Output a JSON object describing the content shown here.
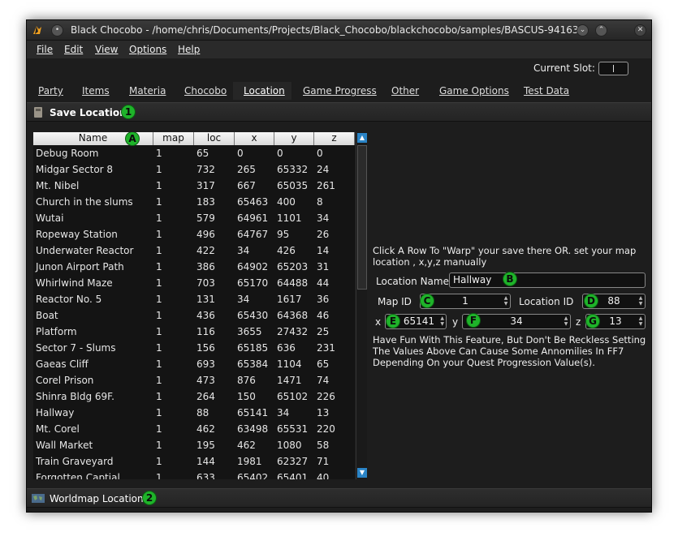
{
  "window": {
    "title": "Black Chocobo - /home/chris/Documents/Projects/Black_Chocobo/blackchocobo/samples/BASCUS-94163..."
  },
  "menu": [
    "File",
    "Edit",
    "View",
    "Options",
    "Help"
  ],
  "slot": {
    "label": "Current Slot:",
    "value": ""
  },
  "tabs": [
    "Party",
    "Items",
    "Materia",
    "Chocobo",
    "Location",
    "Game Progress",
    "Other",
    "Game Options",
    "Test Data"
  ],
  "active_tab": "Location",
  "sections": {
    "save_location": "Save Location",
    "worldmap_location": "Worldmap Location"
  },
  "markers": {
    "one": "1",
    "two": "2",
    "A": "A",
    "B": "B",
    "C": "C",
    "D": "D",
    "E": "E",
    "F": "F",
    "G": "G"
  },
  "table": {
    "columns": [
      "Name",
      "map",
      "loc",
      "x",
      "y",
      "z"
    ],
    "rows": [
      [
        "Debug Room",
        "1",
        "65",
        "0",
        "0",
        "0"
      ],
      [
        "Midgar Sector 8",
        "1",
        "732",
        "265",
        "65332",
        "24"
      ],
      [
        "Mt. Nibel",
        "1",
        "317",
        "667",
        "65035",
        "261"
      ],
      [
        "Church in the slums",
        "1",
        "183",
        "65463",
        "400",
        "8"
      ],
      [
        "Wutai",
        "1",
        "579",
        "64961",
        "1101",
        "34"
      ],
      [
        "Ropeway Station",
        "1",
        "496",
        "64767",
        "95",
        "26"
      ],
      [
        "Underwater Reactor",
        "1",
        "422",
        "34",
        "426",
        "14"
      ],
      [
        "Junon Airport Path",
        "1",
        "386",
        "64902",
        "65203",
        "31"
      ],
      [
        "Whirlwind Maze",
        "1",
        "703",
        "65170",
        "64488",
        "44"
      ],
      [
        "Reactor No. 5",
        "1",
        "131",
        "34",
        "1617",
        "36"
      ],
      [
        "Boat",
        "1",
        "436",
        "65430",
        "64368",
        "46"
      ],
      [
        "Platform",
        "1",
        "116",
        "3655",
        "27432",
        "25"
      ],
      [
        "Sector 7 - Slums",
        "1",
        "156",
        "65185",
        "636",
        "231"
      ],
      [
        "Gaeas Cliff",
        "1",
        "693",
        "65384",
        "1104",
        "65"
      ],
      [
        "Corel Prison",
        "1",
        "473",
        "876",
        "1471",
        "74"
      ],
      [
        "Shinra Bldg 69F.",
        "1",
        "264",
        "150",
        "65102",
        "226"
      ],
      [
        "Hallway",
        "1",
        "88",
        "65141",
        "34",
        "13"
      ],
      [
        "Mt. Corel",
        "1",
        "462",
        "63498",
        "65531",
        "220"
      ],
      [
        "Wall Market",
        "1",
        "195",
        "462",
        "1080",
        "58"
      ],
      [
        "Train Graveyard",
        "1",
        "144",
        "1981",
        "62327",
        "71"
      ],
      [
        "Forgotten Captial",
        "1",
        "633",
        "65402",
        "65401",
        "40"
      ]
    ]
  },
  "info": {
    "line1": "Click A Row To \"Warp\" your save there  OR. set your map",
    "line2": "location , x,y,z manually",
    "warn1": "Have Fun With This Feature, But Don't Be Reckless Setting",
    "warn2": "The Values Above Can Cause Some  Annomilies In FF7",
    "warn3": "Depending On your Quest Progression Value(s)."
  },
  "fields": {
    "location_name_label": "Location Name",
    "location_name_value": "Hallway",
    "map_id_label": "Map ID",
    "map_id_value": "1",
    "location_id_label": "Location ID",
    "location_id_value": "88",
    "x_label": "x",
    "x_value": "65141",
    "y_label": "y",
    "y_value": "34",
    "z_label": "z",
    "z_value": "13"
  },
  "colors": {
    "marker": "#1fb32a",
    "scroll_arrow": "#2a84c6",
    "background": "#1d1d1d"
  }
}
